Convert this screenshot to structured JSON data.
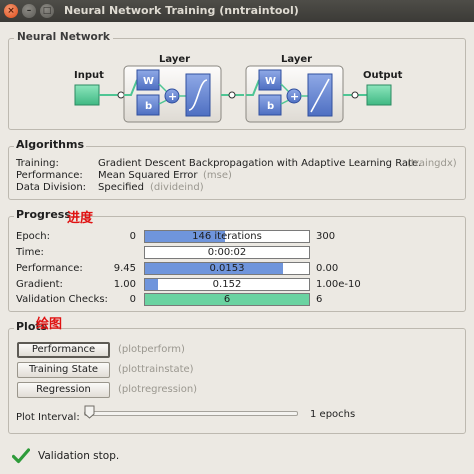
{
  "window": {
    "title": "Neural Network Training (nntraintool)",
    "close_glyph": "×",
    "min_glyph": "–",
    "max_glyph": "□"
  },
  "network": {
    "section_title": "Neural Network",
    "input_label": "Input",
    "output_label": "Output",
    "layer_label": "Layer",
    "weight_label": "W",
    "bias_label": "b",
    "sum_glyph": "+",
    "layers": [
      {
        "transfer": "sigmoid"
      },
      {
        "transfer": "linear"
      }
    ],
    "accent_color": "#4fc594",
    "block_color": "#5f81cf"
  },
  "algorithms": {
    "section_title": "Algorithms",
    "rows": [
      {
        "label": "Training:",
        "value": "Gradient Descent Backpropagation with Adaptive Learning Rate.",
        "code": "(traingdx)"
      },
      {
        "label": "Performance:",
        "value": "Mean Squared Error",
        "code": "(mse)"
      },
      {
        "label": "Data Division:",
        "value": "Specified",
        "code": "(divideind)"
      }
    ]
  },
  "progress": {
    "section_title": "Progress",
    "annotation": "进度",
    "rows": [
      {
        "label": "Epoch:",
        "min": "0",
        "text": "146 iterations",
        "max": "300",
        "fill": 0.49,
        "color": "blue"
      },
      {
        "label": "Time:",
        "min": "",
        "text": "0:00:02",
        "max": "",
        "fill": 0,
        "color": "blue"
      },
      {
        "label": "Performance:",
        "min": "9.45",
        "text": "0.0153",
        "max": "0.00",
        "fill": 0.84,
        "color": "blue"
      },
      {
        "label": "Gradient:",
        "min": "1.00",
        "text": "0.152",
        "max": "1.00e-10",
        "fill": 0.08,
        "color": "blue"
      },
      {
        "label": "Validation Checks:",
        "min": "0",
        "text": "6",
        "max": "6",
        "fill": 1.0,
        "color": "green"
      }
    ]
  },
  "plots": {
    "section_title": "Plots",
    "annotation": "绘图",
    "buttons": [
      {
        "label": "Performance",
        "fn": "(plotperform)"
      },
      {
        "label": "Training State",
        "fn": "(plottrainstate)"
      },
      {
        "label": "Regression",
        "fn": "(plotregression)"
      }
    ],
    "plot_interval_label": "Plot Interval:",
    "interval_value": "1 epochs"
  },
  "status": {
    "icon": "check-icon",
    "text": "Validation stop."
  }
}
